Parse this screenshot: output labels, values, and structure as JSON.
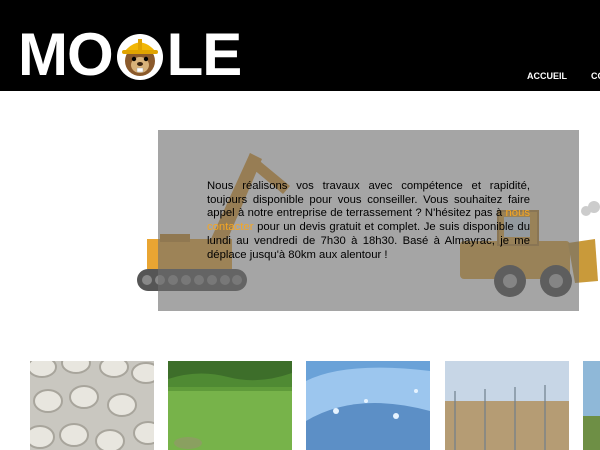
{
  "brand": {
    "logo_left": "MO",
    "logo_right": "LE",
    "mascot_icon": "mole-hardhat-icon"
  },
  "nav": {
    "items": [
      {
        "label": "ACCUEIL"
      },
      {
        "label": "CO"
      }
    ]
  },
  "intro": {
    "text_1": "Nous réalisons vos travaux avec compétence et rapidité, toujours disponible pour vous conseiller. Vous souhaitez faire appel à notre entreprise de terrassement ? N'hésitez pas à ",
    "link_label": "nous contacter",
    "text_2": " pour un devis gratuit et complet. Je suis disponible du lundi au vendredi de 7h30 à 18h30. Basé à Almayrac, je me déplace jusqu'à 80km aux alentour !"
  },
  "gallery": {
    "items": [
      {
        "name": "pipes-image"
      },
      {
        "name": "lawn-image"
      },
      {
        "name": "water-image"
      },
      {
        "name": "fence-image"
      },
      {
        "name": "field-image"
      }
    ]
  },
  "colors": {
    "header_bg": "#000000",
    "accent": "#f5a623",
    "machine_yellow": "#e9a532"
  }
}
